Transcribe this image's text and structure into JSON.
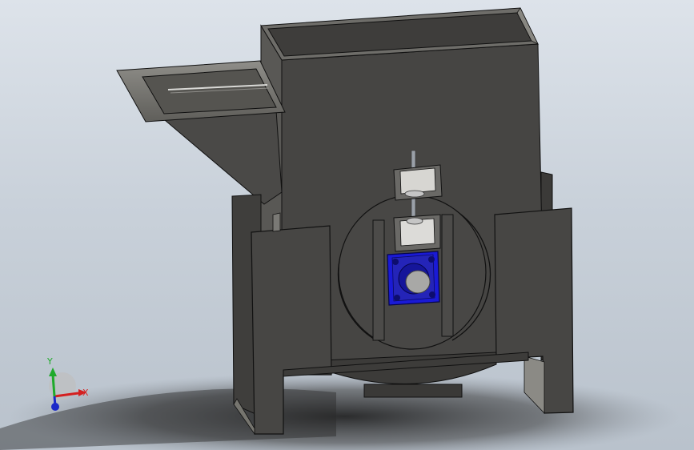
{
  "view": {
    "background_top": "#dde3ea",
    "background_bottom": "#b9c2cc",
    "body_color": "#444341",
    "edge_color": "#111111",
    "bearing_color": "#1a1ad6"
  },
  "triad": {
    "x_label": "X",
    "y_label": "Y",
    "x_color": "#d42020",
    "y_color": "#1faa2a",
    "z_color": "#1a28c8"
  }
}
